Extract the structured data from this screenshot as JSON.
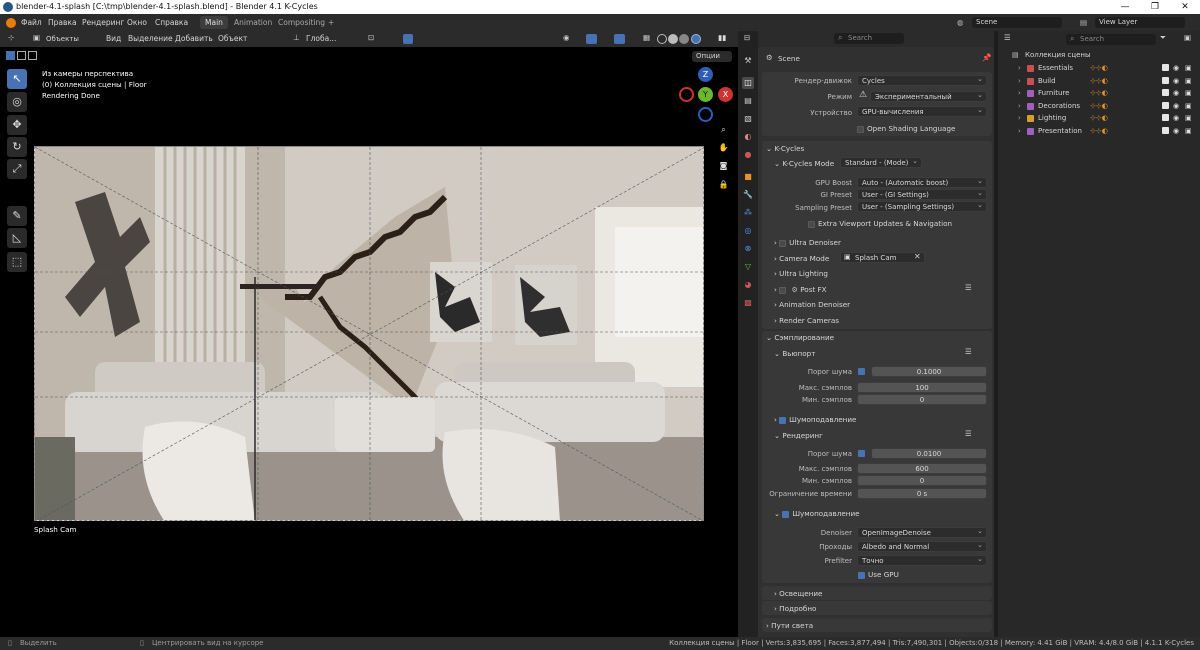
{
  "window": {
    "title": "blender-4.1-splash [C:\\tmp\\blender-4.1-splash.blend] - Blender 4.1 K-Cycles",
    "min": "—",
    "max": "❐",
    "close": "✕"
  },
  "menu": {
    "items": [
      "Файл",
      "Правка",
      "Рендеринг",
      "Окно",
      "Справка"
    ],
    "workspaces": [
      "Main",
      "Animation",
      "Compositing"
    ],
    "add_tab": "+",
    "scene_label": "Scene",
    "view_layer": "View Layer"
  },
  "viewport": {
    "mode": "Объекты",
    "menus": [
      "Вид",
      "Выделение",
      "Добавить",
      "Объект"
    ],
    "transform": "Глоба...",
    "options": "Опции",
    "overlay_lines": [
      "Из камеры перспектива",
      "(0) Коллекция сцены | Floor",
      "Rendering Done"
    ],
    "camera_name": "Splash Cam",
    "axis": {
      "x": "X",
      "y": "Y",
      "z": "Z"
    }
  },
  "properties": {
    "search_placeholder": "Search",
    "scene": "Scene",
    "render_engine_label": "Рендер-движок",
    "render_engine": "Cycles",
    "mode_label": "Режим",
    "mode": "Экспериментальный",
    "device_label": "Устройство",
    "device": "GPU-вычисления",
    "osl": "Open Shading Language",
    "kcycles": "K-Cycles",
    "kcycles_mode_label": "K-Cycles Mode",
    "kcycles_mode": "Standard - (Mode)",
    "gpu_boost_label": "GPU Boost",
    "gpu_boost": "Auto - (Automatic boost)",
    "gi_preset_label": "GI Preset",
    "gi_preset": "User - (GI Settings)",
    "sampling_preset_label": "Sampling Preset",
    "sampling_preset": "User - (Sampling Settings)",
    "extra_updates": "Extra Viewport Updates & Navigation",
    "ultra_denoiser": "Ultra Denoiser",
    "camera_mode_label": "Camera Mode",
    "camera_mode": "Splash Cam",
    "ultra_lighting": "Ultra Lighting",
    "post_fx": "Post FX",
    "animation_denoiser": "Animation Denoiser",
    "render_cameras": "Render Cameras",
    "sampling": "Сэмплирование",
    "viewport_sub": "Вьюпорт",
    "noise_threshold_label": "Порог шума",
    "vp_threshold": "0.1000",
    "vp_max_label": "Макс. сэмплов",
    "vp_max": "100",
    "vp_min_label": "Мин. сэмплов",
    "vp_min": "0",
    "denoise": "Шумоподавление",
    "render_sub": "Рендеринг",
    "r_threshold": "0.0100",
    "r_max": "600",
    "r_min": "0",
    "time_limit_label": "Ограничение времени",
    "time_limit": "0 s",
    "denoiser_label": "Denoiser",
    "denoiser": "OpenImageDenoise",
    "passes_label": "Проходы",
    "passes": "Albedo and Normal",
    "prefilter_label": "Prefilter",
    "prefilter": "Точно",
    "use_gpu": "Use GPU",
    "lighting": "Освещение",
    "details": "Подробно",
    "light_paths": "Пути света"
  },
  "outliner": {
    "search_placeholder": "Search",
    "root": "Коллекция сцены",
    "items": [
      {
        "name": "Essentials",
        "color": "#c75050",
        "counts": [
          "2",
          "2",
          "",
          ""
        ]
      },
      {
        "name": "Build",
        "color": "#c75050",
        "counts": [
          "4",
          "34",
          "",
          ""
        ]
      },
      {
        "name": "Furniture",
        "color": "#a060c0",
        "counts": [
          "26",
          "59",
          "6",
          ""
        ]
      },
      {
        "name": "Decorations",
        "color": "#a060c0",
        "counts": [
          "3",
          "15",
          "6",
          ""
        ]
      },
      {
        "name": "Lighting",
        "color": "#d0a030",
        "counts": [
          "2",
          "5",
          "4",
          ""
        ]
      },
      {
        "name": "Presentation",
        "color": "#a060c0",
        "counts": [
          "",
          "",
          "",
          ""
        ]
      }
    ]
  },
  "status": {
    "left1": "Выделить",
    "left2": "Центрировать вид на курсоре",
    "right": "Коллекция сцены | Floor | Verts:3,835,695 | Faces:3,877,494 | Tris:7,490,301 | Objects:0/318 | Memory: 4.41 GiB | VRAM: 4.4/8.0 GiB | 4.1.1 K-Cycles"
  }
}
